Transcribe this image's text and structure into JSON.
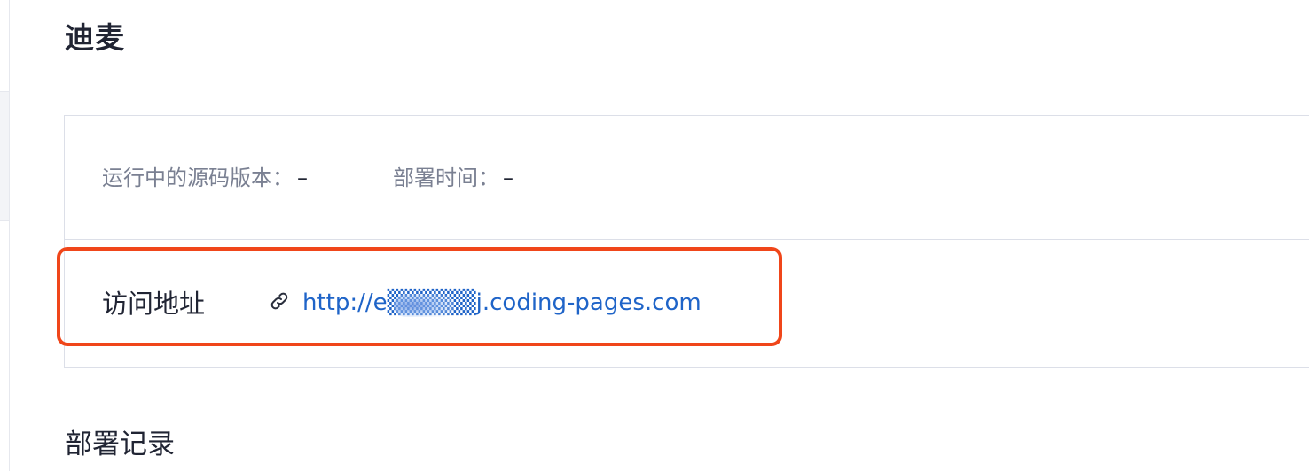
{
  "page": {
    "title": "迪麦"
  },
  "deploy_info": {
    "source_version_label": "运行中的源码版本：",
    "source_version_value": "–",
    "deploy_time_label": "部署时间：",
    "deploy_time_value": "–"
  },
  "access": {
    "label": "访问地址",
    "link_icon": "link-icon",
    "url_text": "http://e▒▒▒▒▒j.coding-pages.com"
  },
  "annotation": {
    "highlight_color": "#f0461a"
  },
  "sections": {
    "deploy_records_title": "部署记录"
  },
  "colors": {
    "link": "#1f64c8",
    "muted_text": "#7a8092",
    "border": "#dcdfe8"
  }
}
